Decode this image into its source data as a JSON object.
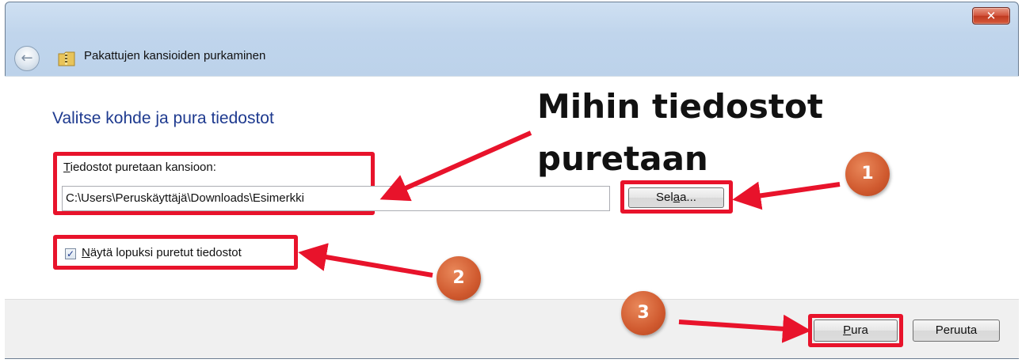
{
  "window": {
    "title": "Pakattujen kansioiden purkaminen",
    "close_symbol": "✕"
  },
  "nav": {
    "back_symbol": "←"
  },
  "main": {
    "heading": "Valitse kohde ja pura tiedostot",
    "folder_label_prefix": "T",
    "folder_label_rest": "iedostot puretaan kansioon:",
    "folder_path": "C:\\Users\\Peruskäyttäjä\\Downloads\\Esimerkki",
    "browse_pre": "Sel",
    "browse_mn": "a",
    "browse_post": "a...",
    "checkbox_checked": true,
    "checkbox_mark": "✓",
    "checkbox_mn": "N",
    "checkbox_rest": "äytä lopuksi puretut tiedostot"
  },
  "footer": {
    "extract_mn": "P",
    "extract_rest": "ura",
    "cancel_label": "Peruuta"
  },
  "annotations": {
    "callout_line1": "Mihin tiedostot",
    "callout_line2": "puretaan",
    "badges": [
      "1",
      "2",
      "3"
    ],
    "highlight_color": "#e8132b",
    "badge_color": "#d05a2f"
  },
  "icons": [
    "close-icon",
    "back-arrow-icon",
    "zip-folder-icon",
    "checkmark-icon"
  ]
}
